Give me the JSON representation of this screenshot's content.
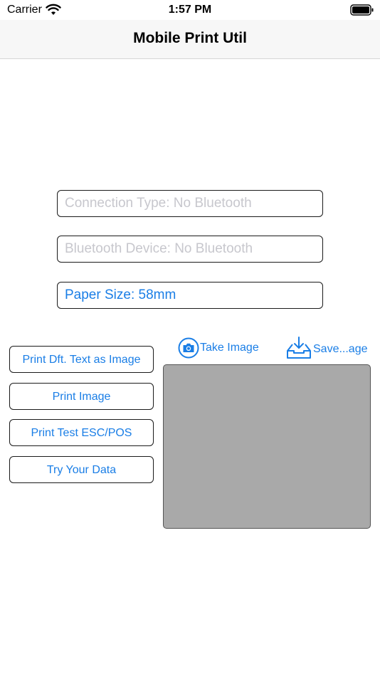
{
  "status_bar": {
    "carrier": "Carrier",
    "time": "1:57 PM",
    "icons": [
      "wifi-icon",
      "battery-icon"
    ]
  },
  "nav": {
    "title": "Mobile Print Util"
  },
  "fields": {
    "connection_type": "Connection Type: No Bluetooth",
    "bluetooth_device": "Bluetooth Device: No Bluetooth",
    "paper_size": "Paper Size: 58mm"
  },
  "buttons": {
    "print_default_text": "Print Dft. Text as Image",
    "print_image": "Print Image",
    "print_test_escpos": "Print Test ESC/POS",
    "try_your_data": "Try Your Data"
  },
  "image_actions": {
    "take_image": "Take Image",
    "save_image": "Save...age",
    "take_icon": "camera-icon",
    "save_icon": "inbox-download-icon"
  },
  "colors": {
    "accent": "#1a7ee6",
    "placeholder": "#c7c7cd",
    "preview_bg": "#a9a9a9",
    "nav_bg": "#f7f7f7"
  }
}
